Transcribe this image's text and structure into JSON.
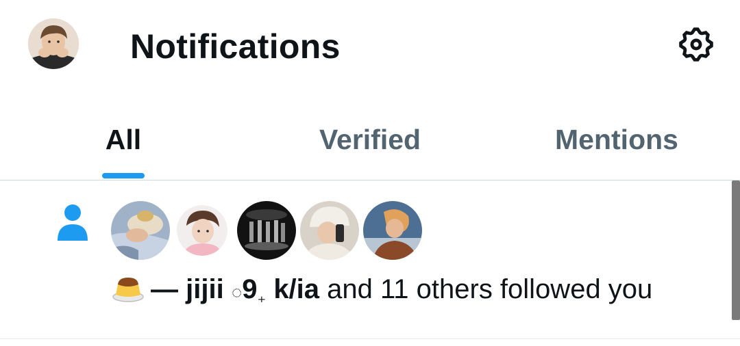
{
  "header": {
    "title": "Notifications",
    "settings_icon": "gear-icon"
  },
  "tabs": [
    {
      "label": "All",
      "active": true
    },
    {
      "label": "Verified",
      "active": false
    },
    {
      "label": "Mentions",
      "active": false
    }
  ],
  "colors": {
    "accent": "#1d9bf0",
    "text_primary": "#0f1419",
    "text_secondary": "#536471",
    "divider": "#cfd9de"
  },
  "notification": {
    "type_icon": "person-icon",
    "avatar_count": 5,
    "emoji": "🍮",
    "user1": "— jijii",
    "user1_suffix_mark": "◌",
    "user1_suffix_num": "9",
    "user1_suffix_sub": "₊",
    "user2": "k/ia",
    "message": "and 11 others followed you"
  }
}
